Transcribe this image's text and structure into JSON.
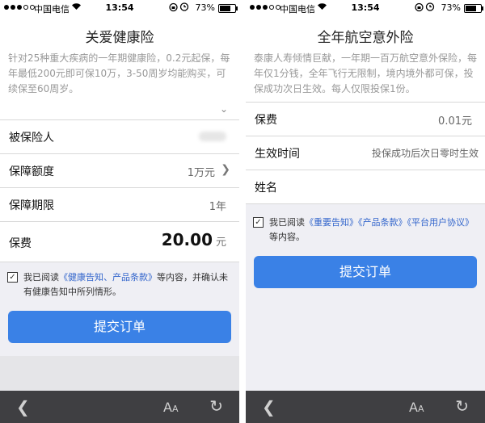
{
  "status": {
    "carrier": "中国电信",
    "time": "13:54",
    "battery": "73%"
  },
  "left": {
    "title": "关爱健康险",
    "description": "针对25种重大疾病的一年期健康险，0.2元起保，每年最低200元即可保10万，3-50周岁均能购买，可续保至60周岁。",
    "rows": {
      "insured_label": "被保险人",
      "coverage_label": "保障额度",
      "coverage_value": "1万元",
      "term_label": "保障期限",
      "term_value": "1年",
      "premium_label": "保费",
      "premium_value": "20.00",
      "premium_unit": "元"
    },
    "agreement": {
      "prefix": "我已阅读",
      "link": "《健康告知、产品条款》",
      "suffix": "等内容，并确认未有健康告知中所列情形。"
    },
    "submit": "提交订单"
  },
  "right": {
    "title": "全年航空意外险",
    "description": "泰康人寿倾情巨献，一年期一百万航空意外保险，每年仅1分钱，全年飞行无限制，境内境外都可保，投保成功次日生效。每人仅限投保1份。",
    "rows": {
      "premium_label": "保费",
      "premium_value": "0.01元",
      "effective_label": "生效时间",
      "effective_value": "投保成功后次日零时生效",
      "name_label": "姓名"
    },
    "agreement": {
      "prefix": "我已阅读",
      "link1": "《重要告知》",
      "link2": "《产品条款》",
      "link3": "《平台用户协议》",
      "suffix": "等内容。"
    },
    "submit": "提交订单"
  },
  "toolbar": {
    "back_icon": "chevron-left-icon",
    "font_icon": "font-size-icon",
    "reload_icon": "reload-icon",
    "font_big": "A",
    "font_small": "A"
  },
  "colors": {
    "accent": "#3a81e6",
    "link": "#3366cc",
    "toolbar": "#3f3f42",
    "background": "#efeff4"
  }
}
